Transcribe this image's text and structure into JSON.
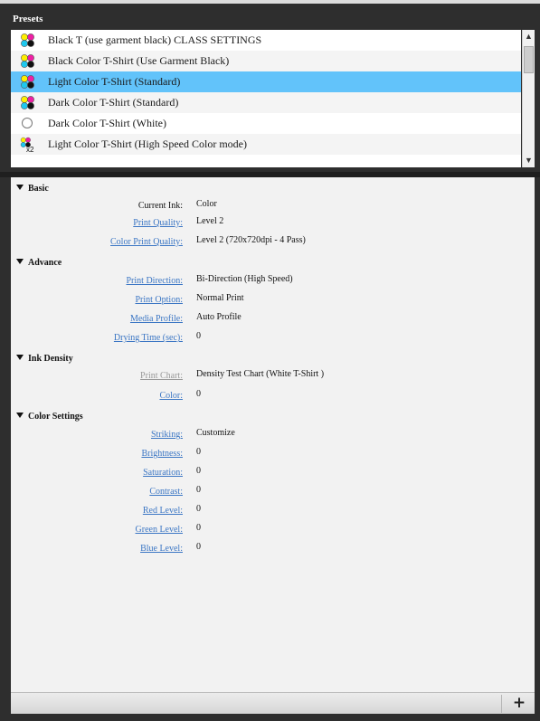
{
  "presets": {
    "title": "Presets",
    "items": [
      {
        "label": "Black T (use garment black) CLASS SETTINGS",
        "icon": "color-dots-icon",
        "selected": false
      },
      {
        "label": "Black Color T-Shirt (Use Garment Black)",
        "icon": "color-dots-icon",
        "selected": false
      },
      {
        "label": "Light Color T-Shirt (Standard)",
        "icon": "color-dots-icon",
        "selected": true
      },
      {
        "label": "Dark Color T-Shirt (Standard)",
        "icon": "color-dots-icon",
        "selected": false
      },
      {
        "label": "Dark Color T-Shirt (White)",
        "icon": "white-circle-icon",
        "selected": false
      },
      {
        "label": "Light Color T-Shirt (High Speed Color mode)",
        "icon": "color-dots-x2-icon",
        "selected": false
      }
    ],
    "x2_badge": "x2"
  },
  "scrollbar": {
    "up_icon": "▲",
    "down_icon": "▼"
  },
  "settings": {
    "basic": {
      "title": "Basic",
      "current_ink_label": "Current Ink:",
      "current_ink_value": "Color",
      "print_quality_label": "Print Quality:",
      "print_quality_value": "Level 2",
      "color_print_quality_label": "Color Print Quality:",
      "color_print_quality_value": "Level 2 (720x720dpi - 4 Pass)"
    },
    "advance": {
      "title": "Advance",
      "print_direction_label": "Print Direction:",
      "print_direction_value": "Bi-Direction (High Speed)",
      "print_option_label": "Print Option:",
      "print_option_value": "Normal Print",
      "media_profile_label": "Media Profile:",
      "media_profile_value": "Auto Profile",
      "drying_time_label": "Drying Time (sec):",
      "drying_time_value": "0"
    },
    "ink_density": {
      "title": "Ink Density",
      "print_chart_label": "Print Chart:",
      "print_chart_value": "Density Test Chart (White T-Shirt )",
      "color_label": "Color:",
      "color_value": "0"
    },
    "color_settings": {
      "title": "Color Settings",
      "striking_label": "Striking:",
      "striking_value": "Customize",
      "brightness_label": "Brightness:",
      "brightness_value": "0",
      "saturation_label": "Saturation:",
      "saturation_value": "0",
      "contrast_label": "Contrast:",
      "contrast_value": "0",
      "red_level_label": "Red Level:",
      "red_level_value": "0",
      "green_level_label": "Green Level:",
      "green_level_value": "0",
      "blue_level_label": "Blue Level:",
      "blue_level_value": "0"
    }
  },
  "toolbar": {
    "add_label": "+"
  },
  "colors": {
    "selection": "#62c3fa",
    "link": "#3b76c4",
    "panel": "#f2f2f2",
    "frame": "#2e2e2e"
  }
}
